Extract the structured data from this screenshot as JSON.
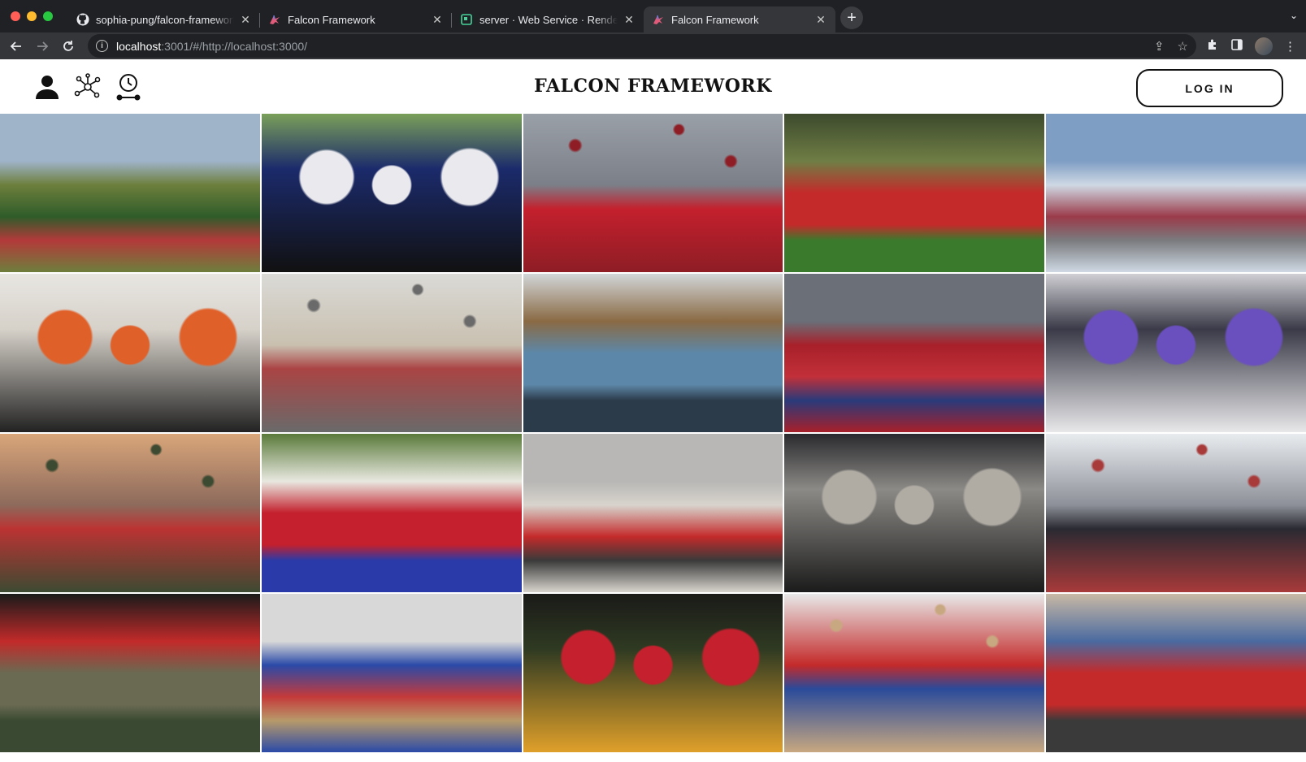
{
  "browser": {
    "tabs": [
      {
        "title": "sophia-pung/falcon-framework",
        "favicon": "github-icon"
      },
      {
        "title": "Falcon Framework",
        "favicon": "falcon-icon"
      },
      {
        "title": "server · Web Service · Render",
        "favicon": "render-icon"
      },
      {
        "title": "Falcon Framework",
        "favicon": "falcon-icon",
        "active": true
      }
    ],
    "url_host": "localhost",
    "url_rest": ":3001/#/http://localhost:3000/"
  },
  "site": {
    "brand": "FALCON FRAMEWORK",
    "login_label": "LOG IN",
    "header_icons": [
      "user-icon",
      "network-icon",
      "timeline-icon"
    ]
  },
  "photos": [
    {
      "name": "photo-stadium-aerial",
      "colors": [
        "#9fb3c9",
        "#6d7f3c",
        "#2f5c2a",
        "#b33a3a"
      ]
    },
    {
      "name": "photo-marching-drumline",
      "colors": [
        "#7aa05a",
        "#1b2a6b",
        "#e9e9ee",
        "#111"
      ]
    },
    {
      "name": "photo-graduation-cap-toss",
      "colors": [
        "#9aa0a8",
        "#7b7f88",
        "#c4202d",
        "#8e1d25"
      ]
    },
    {
      "name": "photo-cross-country-race",
      "colors": [
        "#3d4a2d",
        "#6f7e45",
        "#c42a2a",
        "#3a7a2d"
      ]
    },
    {
      "name": "photo-stadium-crowd",
      "colors": [
        "#7f9ec4",
        "#cfd9e4",
        "#9b3b4a",
        "#7a7b7e"
      ]
    },
    {
      "name": "photo-women-in-stem-mural",
      "colors": [
        "#e8e6e2",
        "#d6d1c9",
        "#e0602a",
        "#222"
      ]
    },
    {
      "name": "photo-classroom-teacher",
      "colors": [
        "#dadad6",
        "#c9c0b0",
        "#a44",
        "#6a6a6a"
      ]
    },
    {
      "name": "photo-library-students",
      "colors": [
        "#d2d6d8",
        "#8a6a44",
        "#5d87a8",
        "#2c3b4a"
      ]
    },
    {
      "name": "photo-graduation-ceremony",
      "colors": [
        "#6a6f78",
        "#a8202a",
        "#c23039",
        "#2a3a7a"
      ]
    },
    {
      "name": "photo-podcast-studio",
      "colors": [
        "#cfcfd4",
        "#3a3a48",
        "#6a4fbf",
        "#e8e8ea"
      ]
    },
    {
      "name": "photo-football-team-sunset",
      "colors": [
        "#d9a67a",
        "#8d6a5c",
        "#b33",
        "#3d4a32"
      ]
    },
    {
      "name": "photo-graduates-group",
      "colors": [
        "#5a7a3a",
        "#e8e8e0",
        "#c4202d",
        "#2a3aa8"
      ]
    },
    {
      "name": "photo-student-section-gym",
      "colors": [
        "#b8b7b5",
        "#d8d4cd",
        "#c42a2a",
        "#3a3a3a"
      ]
    },
    {
      "name": "photo-band-concert",
      "colors": [
        "#2a2a2e",
        "#8c8a86",
        "#b0aca4",
        "#1b1b1b"
      ]
    },
    {
      "name": "photo-outdoor-pep-rally",
      "colors": [
        "#e9ecef",
        "#8d9098",
        "#2a2a32",
        "#a83a3a"
      ]
    },
    {
      "name": "photo-theater-performance",
      "colors": [
        "#1a1a1a",
        "#c22a2a",
        "#6a6a52",
        "#3a4a32"
      ]
    },
    {
      "name": "photo-gym-dance",
      "colors": [
        "#d8d8d8",
        "#2a4aa8",
        "#c43a3a",
        "#b89a6a"
      ]
    },
    {
      "name": "photo-graduation-speech",
      "colors": [
        "#1a1a18",
        "#2f3a22",
        "#c4202d",
        "#e0a02a"
      ]
    },
    {
      "name": "photo-falcon-gym-volleyball",
      "colors": [
        "#e8e8e8",
        "#c42a2a",
        "#2a4a9a",
        "#c8a880"
      ]
    },
    {
      "name": "photo-tailgate-friends",
      "colors": [
        "#c9b9a5",
        "#4a6aa0",
        "#c42a2a",
        "#3a3a3a"
      ]
    }
  ],
  "colors": {
    "chrome_dark": "#202124",
    "chrome_mid": "#35363a",
    "accent_red": "#c4202d"
  }
}
